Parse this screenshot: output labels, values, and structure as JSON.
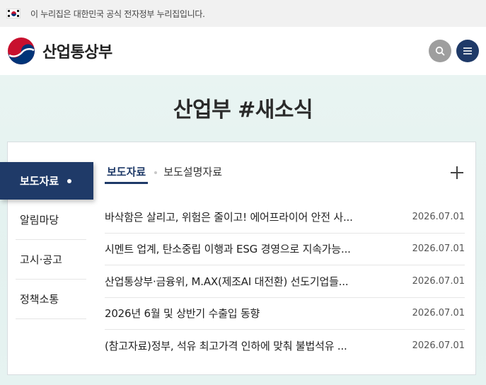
{
  "gov_banner": {
    "text": "이 누리집은 대한민국 공식 전자정부 누리집입니다."
  },
  "header": {
    "site_name": "산업통상부",
    "search_icon": "search-icon",
    "menu_icon": "hamburger-menu-icon"
  },
  "colors": {
    "primary": "#1f3a68",
    "search_bg": "#9e9e9e",
    "hero_bg": "#e9f4f2"
  },
  "section": {
    "title": "산업부 #새소식"
  },
  "side_nav": {
    "items": [
      {
        "label": "보도자료",
        "active": true
      },
      {
        "label": "알림마당"
      },
      {
        "label": "고시·공고"
      },
      {
        "label": "정책소통"
      }
    ]
  },
  "tabs": [
    {
      "label": "보도자료",
      "active": true
    },
    {
      "label": "보도설명자료"
    }
  ],
  "more_icon": "plus-icon",
  "news": [
    {
      "title": "바삭함은 살리고, 위험은 줄이고! 에어프라이어 안전 사...",
      "date": "2026.07.01"
    },
    {
      "title": "시멘트 업계, 탄소중립 이행과 ESG 경영으로 지속가능...",
      "date": "2026.07.01"
    },
    {
      "title": "산업통상부·금융위, M.AX(제조AI 대전환) 선도기업들...",
      "date": "2026.07.01"
    },
    {
      "title": "2026년 6월 및 상반기 수출입 동향",
      "date": "2026.07.01"
    },
    {
      "title": "(참고자료)정부, 석유 최고가격 인하에 맞춰 불법석유 ...",
      "date": "2026.07.01"
    }
  ]
}
